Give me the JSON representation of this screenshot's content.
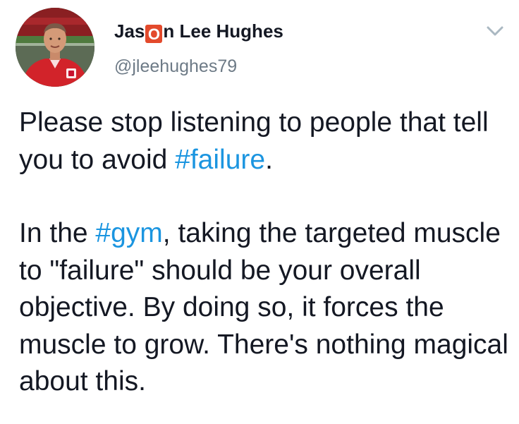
{
  "author": {
    "name_part1": "Jas",
    "name_emoji": "O",
    "name_part2": "n Lee Hughes",
    "handle": "@jleehughes79",
    "avatar_icon": "profile-photo-icon",
    "emoji_color": "#e34a2c"
  },
  "menu": {
    "icon": "chevron-down-icon"
  },
  "tweet": {
    "p1_before": "Please stop listening to people that tell you to avoid ",
    "p1_hashtag": "#failure",
    "p1_after": ".",
    "p2_before": "In the ",
    "p2_hashtag": "#gym",
    "p2_after": ", taking the targeted muscle to \"failure\" should be your overall objective. By doing so, it forces the muscle to grow. There's nothing magical about this."
  },
  "colors": {
    "text": "#141823",
    "hashtag": "#1b95e0",
    "handle": "#6d7a86"
  }
}
